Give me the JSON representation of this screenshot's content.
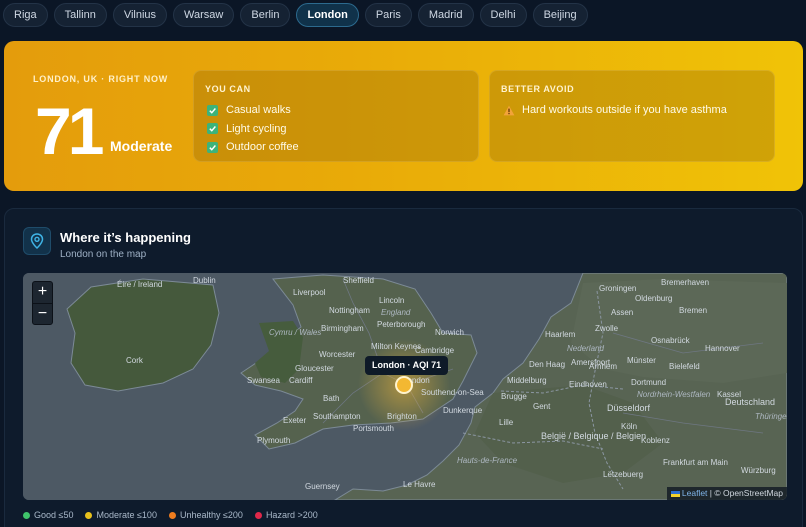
{
  "cities": [
    {
      "label": "Riga"
    },
    {
      "label": "Tallinn"
    },
    {
      "label": "Vilnius"
    },
    {
      "label": "Warsaw"
    },
    {
      "label": "Berlin"
    },
    {
      "label": "London"
    },
    {
      "label": "Paris"
    },
    {
      "label": "Madrid"
    },
    {
      "label": "Delhi"
    },
    {
      "label": "Beijing"
    }
  ],
  "selected_city": "London",
  "hero": {
    "kicker": "LONDON, UK · RIGHT NOW",
    "aqi": "71",
    "level": "Moderate",
    "you_can_title": "YOU CAN",
    "you_can": [
      "Casual walks",
      "Light cycling",
      "Outdoor coffee"
    ],
    "avoid_title": "BETTER AVOID",
    "avoid": [
      "Hard workouts outside if you have asthma"
    ]
  },
  "map_section": {
    "title": "Where it’s happening",
    "subtitle": "London on the map",
    "zoom_in": "+",
    "zoom_out": "−",
    "marker_tooltip": "London · AQI 71",
    "attribution_leaflet": "Leaflet",
    "attribution_osm": "| © OpenStreetMap",
    "place_labels": {
      "eire": "Éire / Ireland",
      "dublin": "Dublin",
      "cork": "Cork",
      "sheffield": "Sheffield",
      "liverpool": "Liverpool",
      "lincoln": "Lincoln",
      "nottingham": "Nottingham",
      "england": "England",
      "birmingham": "Birmingham",
      "peterborough": "Peterborough",
      "cymru": "Cymru / Wales",
      "norwich": "Norwich",
      "worcester": "Worcester",
      "milton": "Milton Keynes",
      "cambridge": "Cambridge",
      "swansea": "Swansea",
      "gloucester": "Gloucester",
      "cardiff": "Cardiff",
      "london": "London",
      "southend": "Southend-on-Sea",
      "bath": "Bath",
      "southampton": "Southampton",
      "brighton": "Brighton",
      "portsmouth": "Portsmouth",
      "exeter": "Exeter",
      "plymouth": "Plymouth",
      "guernsey": "Guernsey",
      "lehavre": "Le Havre",
      "groningen": "Groningen",
      "oldenburg": "Oldenburg",
      "bremerhaven": "Bremerhaven",
      "bremen": "Bremen",
      "assen": "Assen",
      "nederland": "Nederland",
      "haarlem": "Haarlem",
      "zwolle": "Zwolle",
      "osnabruck": "Osnabrück",
      "hannover": "Hannover",
      "denhaag": "Den Haag",
      "amersfoort": "Amersfoort",
      "arnhem": "Arnhem",
      "munster": "Münster",
      "bielefeld": "Bielefeld",
      "eindhoven": "Eindhoven",
      "middelburg": "Middelburg",
      "dortmund": "Dortmund",
      "nordrhein": "Nordrhein-Westfalen",
      "bruges": "Brugge",
      "dusseldorf": "Düsseldorf",
      "gent": "Gent",
      "kassel": "Kassel",
      "dunkerque": "Dunkerque",
      "deutschland": "Deutschland",
      "thuringen": "Thüringen",
      "lille": "Lille",
      "belgie": "België / Belgique / Belgien",
      "koln": "Köln",
      "koblenz": "Koblenz",
      "hauts": "Hauts-de-France",
      "frankfurt": "Frankfurt am Main",
      "luxembourg": "Lëtzebuerg",
      "wurzburg": "Würzburg"
    }
  },
  "legend": [
    {
      "label": "Good ≤50",
      "color": "#3fc46b"
    },
    {
      "label": "Moderate ≤100",
      "color": "#e8c11c"
    },
    {
      "label": "Unhealthy ≤200",
      "color": "#ee7d1f"
    },
    {
      "label": "Hazard >200",
      "color": "#e0284a"
    }
  ],
  "colors": {
    "accent": "#f0b70a",
    "background": "#0b1626"
  }
}
